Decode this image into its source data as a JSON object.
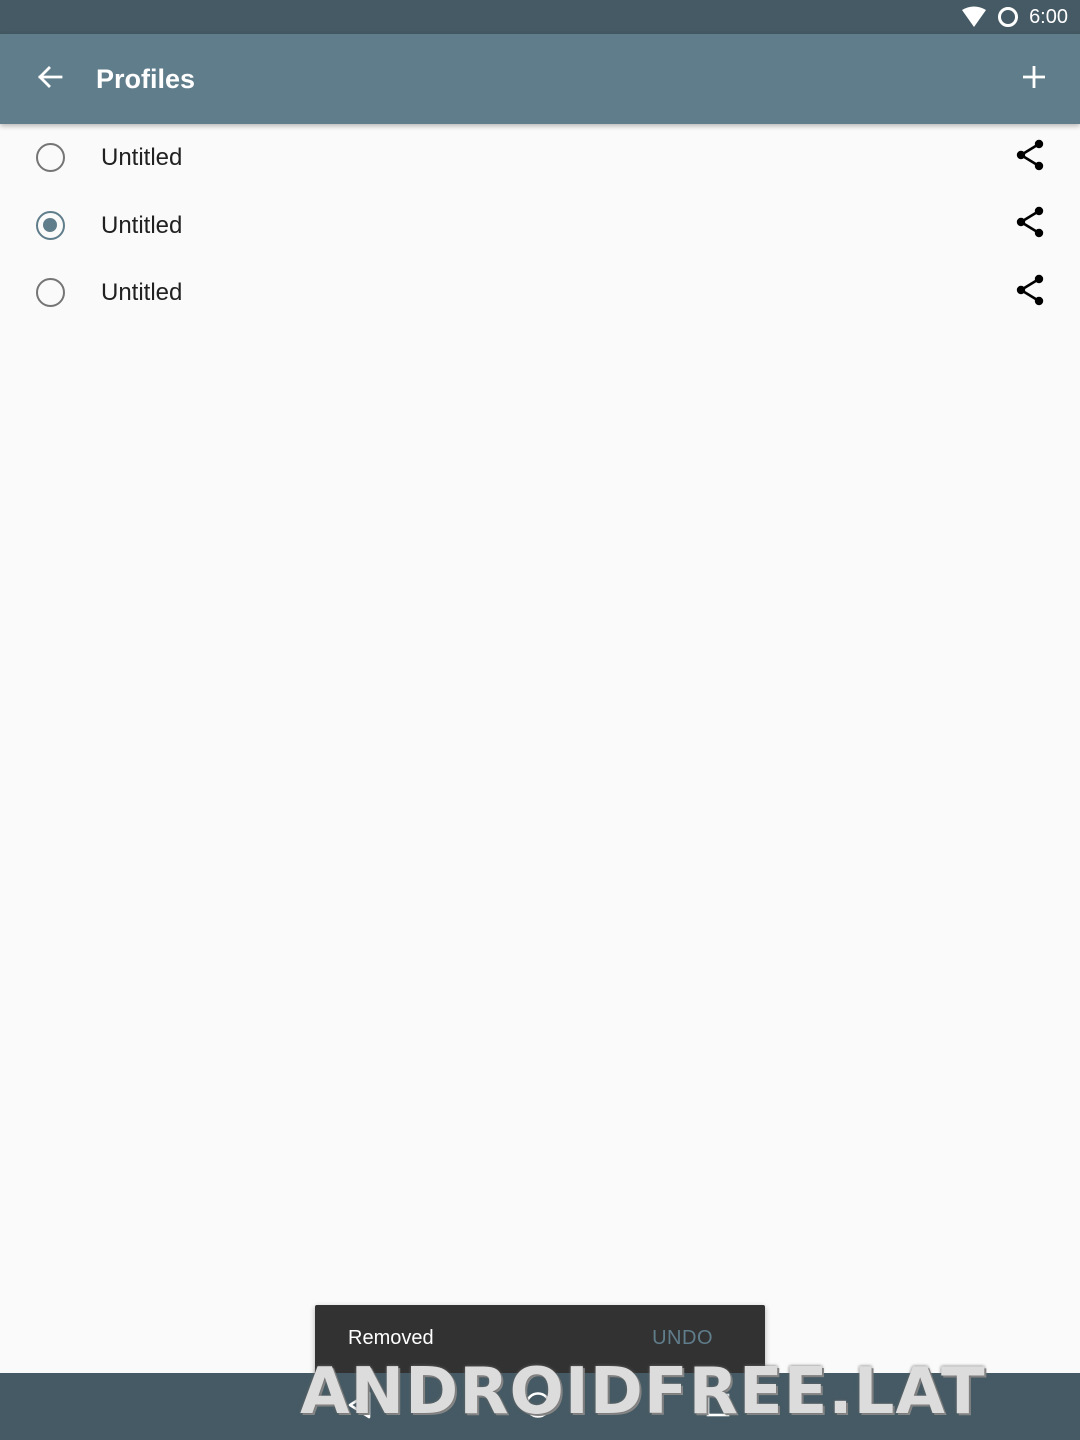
{
  "status_bar": {
    "time": "6:00",
    "icons": [
      "wifi-icon",
      "sync-circle-icon"
    ]
  },
  "app_bar": {
    "title": "Profiles",
    "back_icon": "arrow-back-icon",
    "add_icon": "plus-icon",
    "colors": {
      "app_bar": "#607d8b",
      "status_bar": "#455a64"
    }
  },
  "profiles": [
    {
      "name": "Untitled",
      "selected": false,
      "share_icon": "share-icon"
    },
    {
      "name": "Untitled",
      "selected": true,
      "share_icon": "share-icon"
    },
    {
      "name": "Untitled",
      "selected": false,
      "share_icon": "share-icon"
    }
  ],
  "snackbar": {
    "message": "Removed",
    "action": "UNDO"
  },
  "nav_bar": {
    "icons": [
      "back-triangle-icon",
      "home-circle-icon",
      "recents-square-icon"
    ]
  },
  "watermark": {
    "text": "ANDROIDFREE.LAT"
  }
}
